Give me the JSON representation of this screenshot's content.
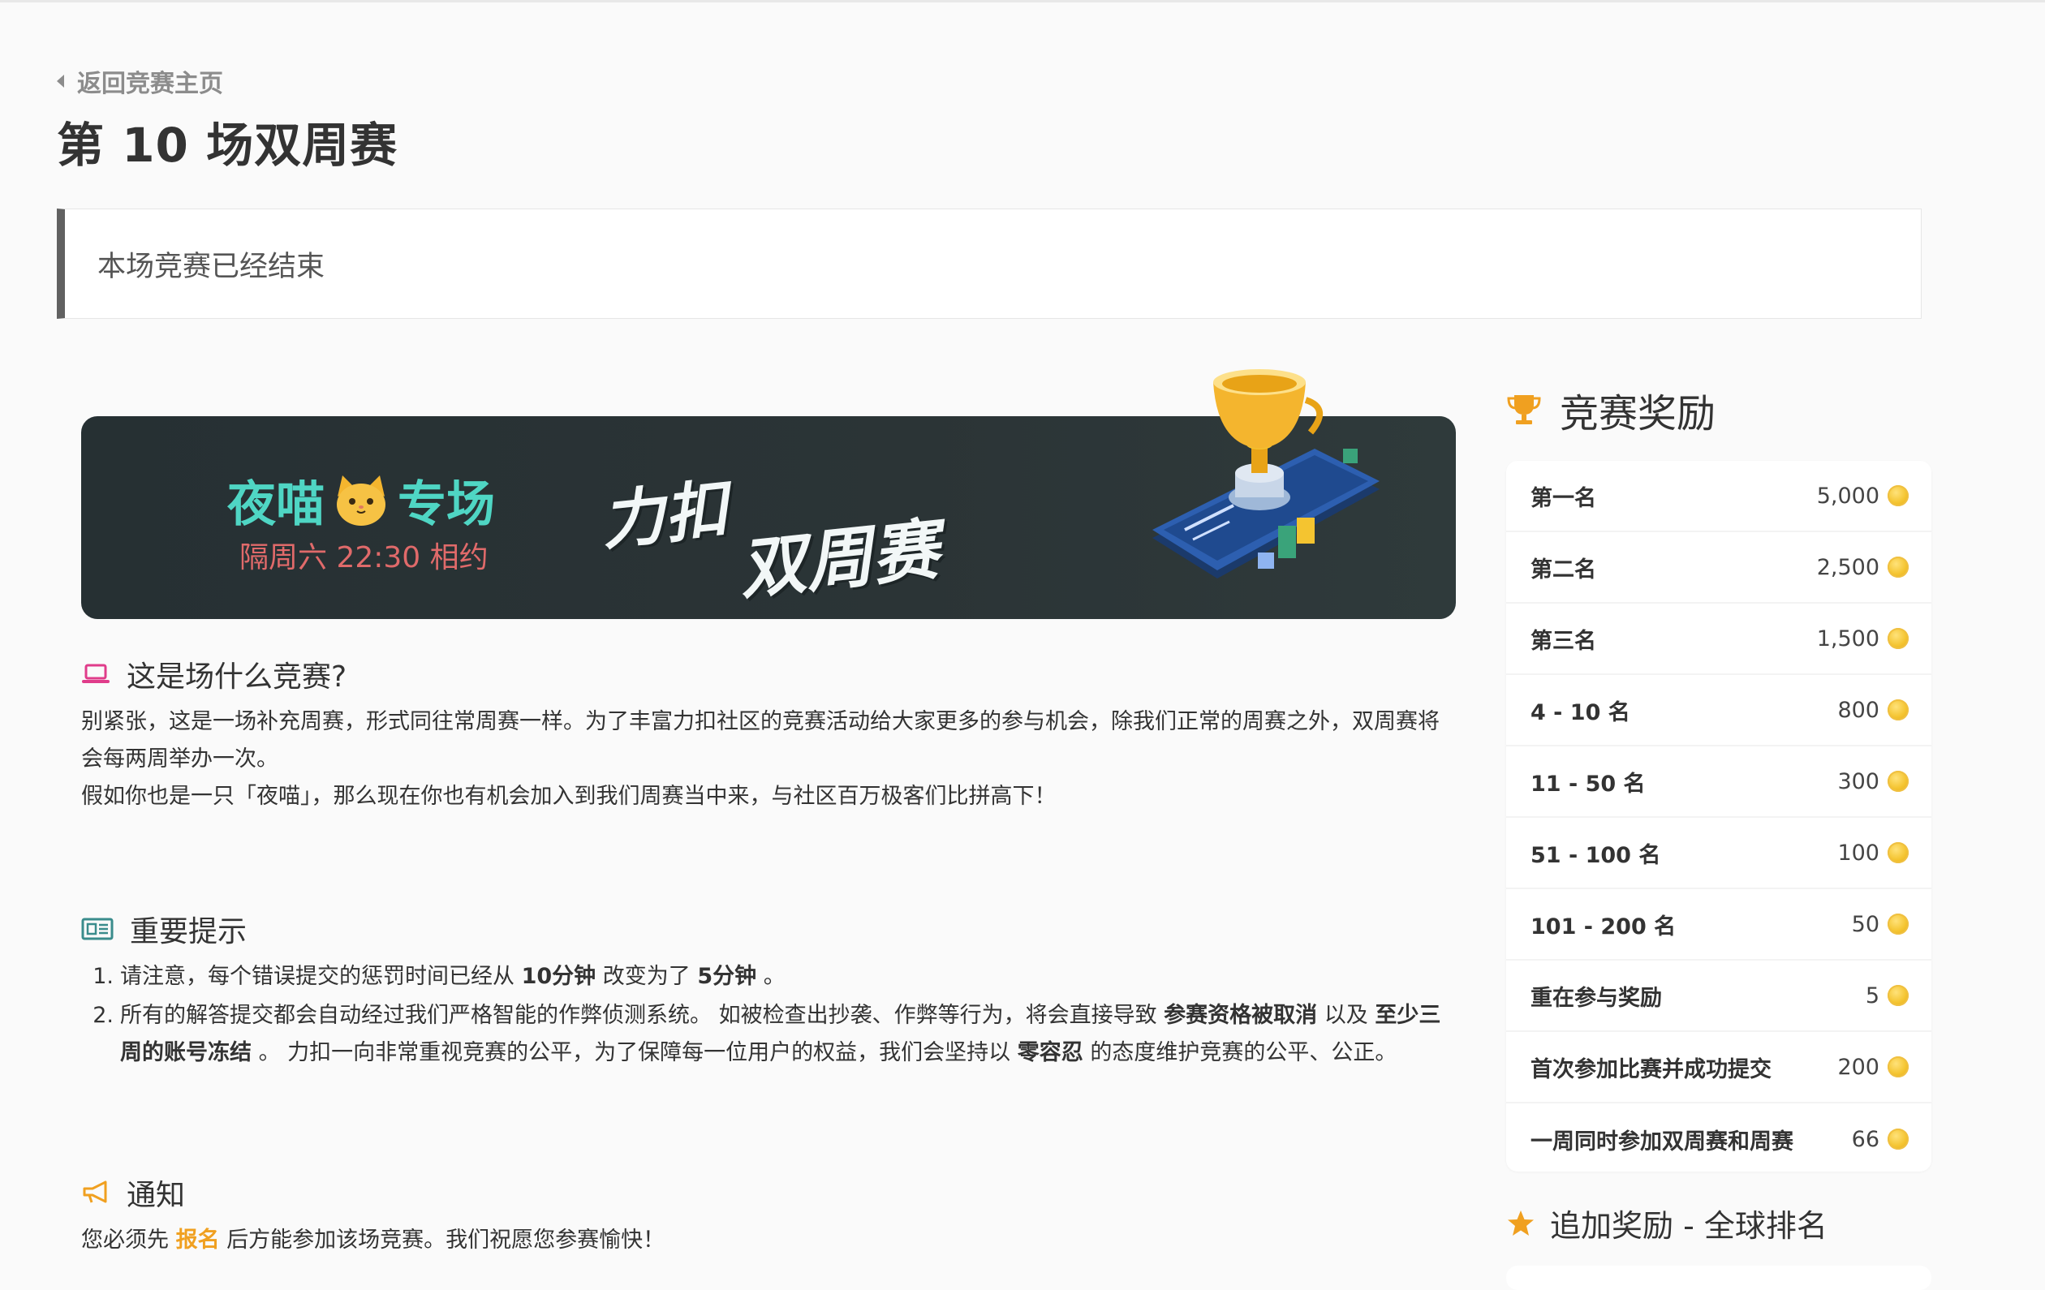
{
  "nav": {
    "back_label": "返回竞赛主页"
  },
  "page": {
    "title": "第 10 场双周赛",
    "status": "本场竞赛已经结束"
  },
  "banner": {
    "left_title_a": "夜喵",
    "left_title_b": "专场",
    "subtitle": "隔周六 22:30 相约",
    "big_a": "力扣",
    "big_b": "双周赛"
  },
  "about": {
    "heading": "这是场什么竞赛?",
    "p1": "别紧张，这是一场补充周赛，形式同往常周赛一样。为了丰富力扣社区的竞赛活动给大家更多的参与机会，除我们正常的周赛之外，双周赛将会每两周举办一次。",
    "p2": "假如你也是一只「夜喵」，那么现在你也有机会加入到我们周赛当中来，与社区百万极客们比拼高下！"
  },
  "notice": {
    "heading": "重要提示",
    "item1": {
      "num": "1.",
      "t1": "请注意，每个错误提交的惩罚时间已经从 ",
      "b1": "10分钟",
      "t2": " 改变为了 ",
      "b2": "5分钟",
      "t3": " 。"
    },
    "item2": {
      "num": "2.",
      "t1": "所有的解答提交都会自动经过我们严格智能的作弊侦测系统。 如被检查出抄袭、作弊等行为，将会直接导致 ",
      "b1": "参赛资格被取消",
      "t2": " 以及 ",
      "b2": "至少三周的账号冻结",
      "t3": " 。 力扣一向非常重视竞赛的公平，为了保障每一位用户的权益，我们会坚持以 ",
      "b3": "零容忍",
      "t4": " 的态度维护竞赛的公平、公正。"
    }
  },
  "announce": {
    "heading": "通知",
    "t1": "您必须先 ",
    "link": "报名",
    "t2": " 后方能参加该场竞赛。我们祝愿您参赛愉快！"
  },
  "rewards": {
    "title": "竞赛奖励",
    "items": [
      {
        "name": "第一名",
        "value": "5,000"
      },
      {
        "name": "第二名",
        "value": "2,500"
      },
      {
        "name": "第三名",
        "value": "1,500"
      },
      {
        "name": "4 - 10 名",
        "value": "800"
      },
      {
        "name": "11 - 50 名",
        "value": "300"
      },
      {
        "name": "51 - 100 名",
        "value": "100"
      },
      {
        "name": "101 - 200 名",
        "value": "50"
      },
      {
        "name": "重在参与奖励",
        "value": "5"
      },
      {
        "name": "首次参加比赛并成功提交",
        "value": "200"
      },
      {
        "name": "一周同时参加双周赛和周赛",
        "value": "66"
      }
    ],
    "bonus_title": "追加奖励 - 全球排名"
  },
  "colors": {
    "accent_orange": "#f0a020",
    "banner_bg": "#263033",
    "teal": "#4fd6c4",
    "status_bar": "#616161"
  }
}
